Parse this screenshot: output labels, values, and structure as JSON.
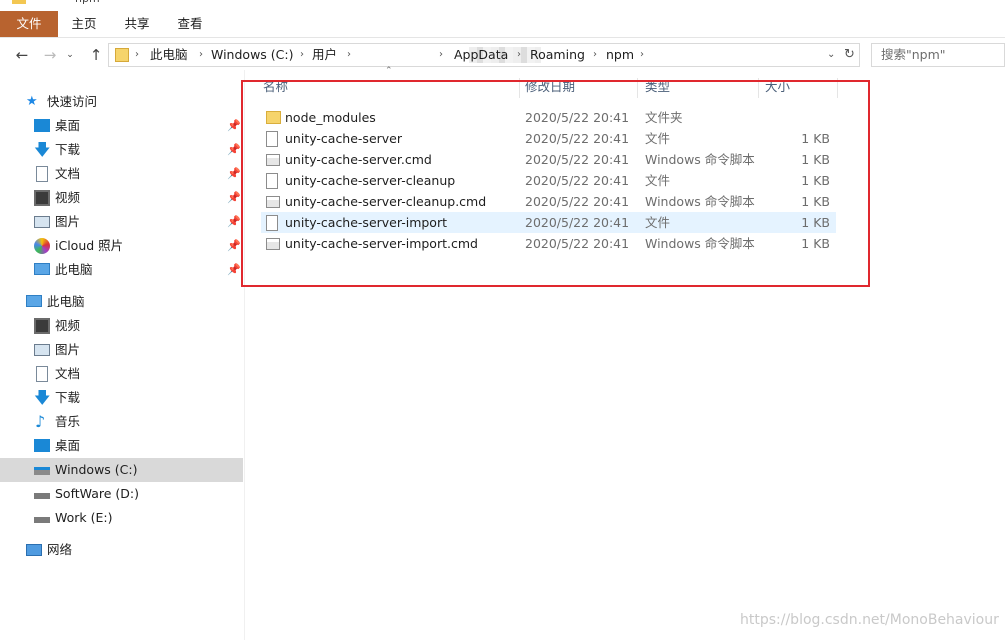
{
  "window": {
    "title_fragment": "npm"
  },
  "ribbon": {
    "tabs": [
      "文件",
      "主页",
      "共享",
      "查看"
    ]
  },
  "address_bar": {
    "segments": [
      "此电脑",
      "Windows (C:)",
      "用户",
      "AppData",
      "Roaming",
      "npm"
    ]
  },
  "search": {
    "placeholder": "搜索\"npm\""
  },
  "sidebar": {
    "quick_access": {
      "label": "快速访问",
      "items": [
        "桌面",
        "下载",
        "文档",
        "视频",
        "图片",
        "iCloud 照片",
        "此电脑"
      ]
    },
    "this_pc": {
      "label": "此电脑",
      "items": [
        "视频",
        "图片",
        "文档",
        "下载",
        "音乐",
        "桌面",
        "Windows (C:)",
        "SoftWare (D:)",
        "Work (E:)"
      ]
    },
    "network": {
      "label": "网络"
    },
    "selected": "Windows (C:)"
  },
  "columns": {
    "name": "名称",
    "date": "修改日期",
    "type": "类型",
    "size": "大小"
  },
  "files": [
    {
      "name": "node_modules",
      "date": "2020/5/22 20:41",
      "type": "文件夹",
      "size": "",
      "icon": "folder-icon"
    },
    {
      "name": "unity-cache-server",
      "date": "2020/5/22 20:41",
      "type": "文件",
      "size": "1 KB",
      "icon": "file-icon"
    },
    {
      "name": "unity-cache-server.cmd",
      "date": "2020/5/22 20:41",
      "type": "Windows 命令脚本",
      "size": "1 KB",
      "icon": "cmd-file-icon"
    },
    {
      "name": "unity-cache-server-cleanup",
      "date": "2020/5/22 20:41",
      "type": "文件",
      "size": "1 KB",
      "icon": "file-icon"
    },
    {
      "name": "unity-cache-server-cleanup.cmd",
      "date": "2020/5/22 20:41",
      "type": "Windows 命令脚本",
      "size": "1 KB",
      "icon": "cmd-file-icon"
    },
    {
      "name": "unity-cache-server-import",
      "date": "2020/5/22 20:41",
      "type": "文件",
      "size": "1 KB",
      "icon": "file-icon"
    },
    {
      "name": "unity-cache-server-import.cmd",
      "date": "2020/5/22 20:41",
      "type": "Windows 命令脚本",
      "size": "1 KB",
      "icon": "cmd-file-icon"
    }
  ],
  "highlighted_row": "unity-cache-server-import",
  "watermark": "https://blog.csdn.net/MonoBehaviour",
  "colors": {
    "accent": "#b8632f",
    "highlight_box": "#e0282e",
    "selection": "#e5f3ff"
  }
}
